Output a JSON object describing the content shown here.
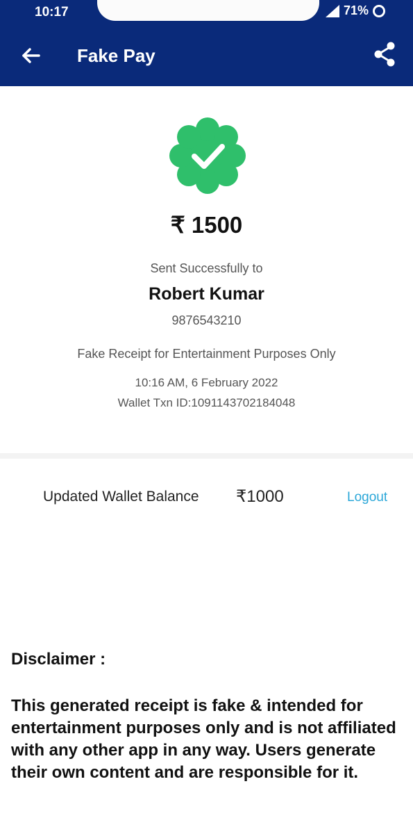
{
  "status_bar": {
    "time": "10:17",
    "battery": "71%",
    "icons": [
      "signal-icon",
      "battery-ring-icon"
    ]
  },
  "app_bar": {
    "title": "Fake Pay",
    "back_icon": "arrow-left-icon",
    "share_icon": "share-icon",
    "color": "#0a2a7a"
  },
  "receipt": {
    "status_icon": "verified-check-icon",
    "status_color": "#2fbf6b",
    "amount": "₹ 1500",
    "sent_label": "Sent Successfully to",
    "receiver_name": "Robert Kumar",
    "receiver_phone": "9876543210",
    "note": "Fake Receipt for Entertainment Purposes Only",
    "datetime": "10:16 AM,  6 February 2022",
    "txn_id": "Wallet Txn ID:1091143702184048"
  },
  "wallet": {
    "label": "Updated Wallet Balance",
    "value": "₹1000",
    "logout": "Logout",
    "logout_color": "#2ba7d8"
  },
  "disclaimer": {
    "title": "Disclaimer :",
    "text": "This generated receipt is fake & intended for entertainment purposes only and is not affiliated with any other app in any way. Users generate their own content and are responsible for it."
  }
}
